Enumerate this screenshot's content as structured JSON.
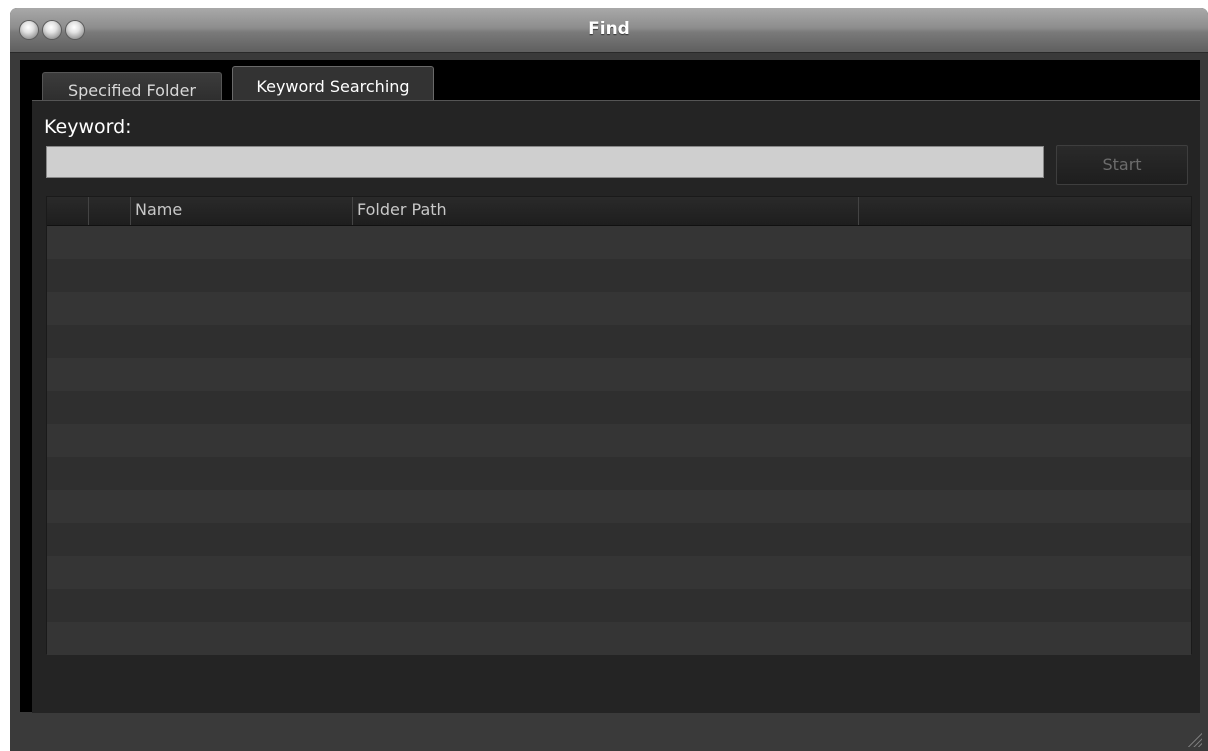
{
  "window": {
    "title": "Find"
  },
  "tabs": [
    {
      "label": "Specified Folder",
      "active": false
    },
    {
      "label": "Keyword Searching",
      "active": true
    }
  ],
  "search": {
    "label": "Keyword:",
    "value": "",
    "placeholder": "",
    "start_label": "Start"
  },
  "table": {
    "columns": [
      "",
      "",
      "Name",
      "Folder Path",
      ""
    ],
    "rows": []
  },
  "colors": {
    "background": "#242424",
    "input": "#cfcfcf",
    "button_text_disabled": "#6c6c6c"
  }
}
